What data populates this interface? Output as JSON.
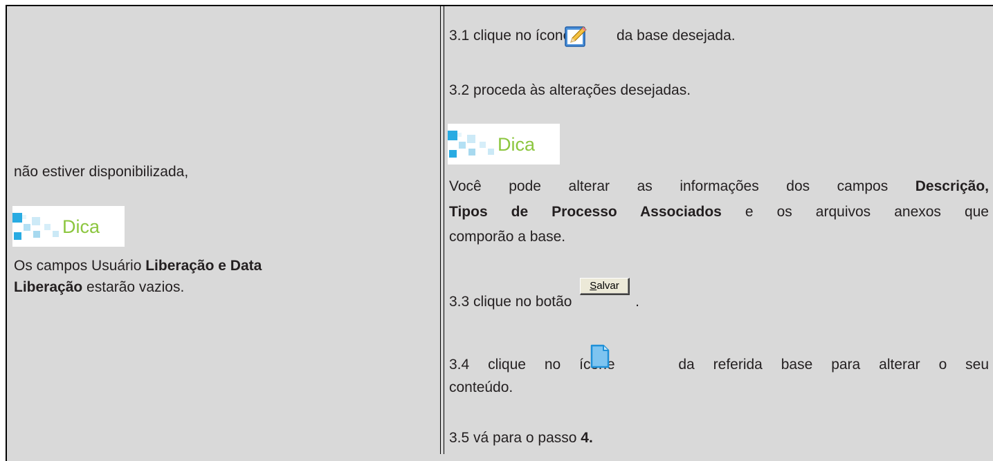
{
  "left": {
    "line1": "não estiver disponibilizada,",
    "tip_label": "Dica",
    "tip_line1_pre": "Os campos Usuário ",
    "tip_line1_bold": "Liberação e Data",
    "tip_line2_bold": "Liberação",
    "tip_line2_post": " estarão vazios."
  },
  "right": {
    "step31_pre": "3.1 clique no ícone",
    "step31_post": "da base desejada.",
    "step32": "3.2 proceda às alterações desejadas.",
    "tip_label": "Dica",
    "tip_line1_pre": "Você pode alterar as informações dos campos ",
    "tip_line1_bold": "Descrição,",
    "tip_line2_bold": "Tipos de Processo Associados",
    "tip_line2_post": " e os arquivos anexos que",
    "tip_line3": "comporão a base.",
    "step33_pre": "3.3 clique no botão",
    "step33_post": ".",
    "salvar_button_first": "S",
    "salvar_button_rest": "alvar",
    "step34_pre": "3.4 clique no ícone",
    "step34_post": "da referida base para alterar o seu",
    "step34_line2": "conteúdo.",
    "step35_pre": "3.5 vá para o passo ",
    "step35_bold": "4."
  },
  "icons": {
    "edit": "pencil-edit-icon",
    "document": "blank-document-icon",
    "tip": "dica-tip-icon"
  },
  "colors": {
    "cell_background": "#d9d9d9",
    "tip_green": "#8cc63f",
    "tip_blue": "#29abe2",
    "text": "#231f20"
  }
}
